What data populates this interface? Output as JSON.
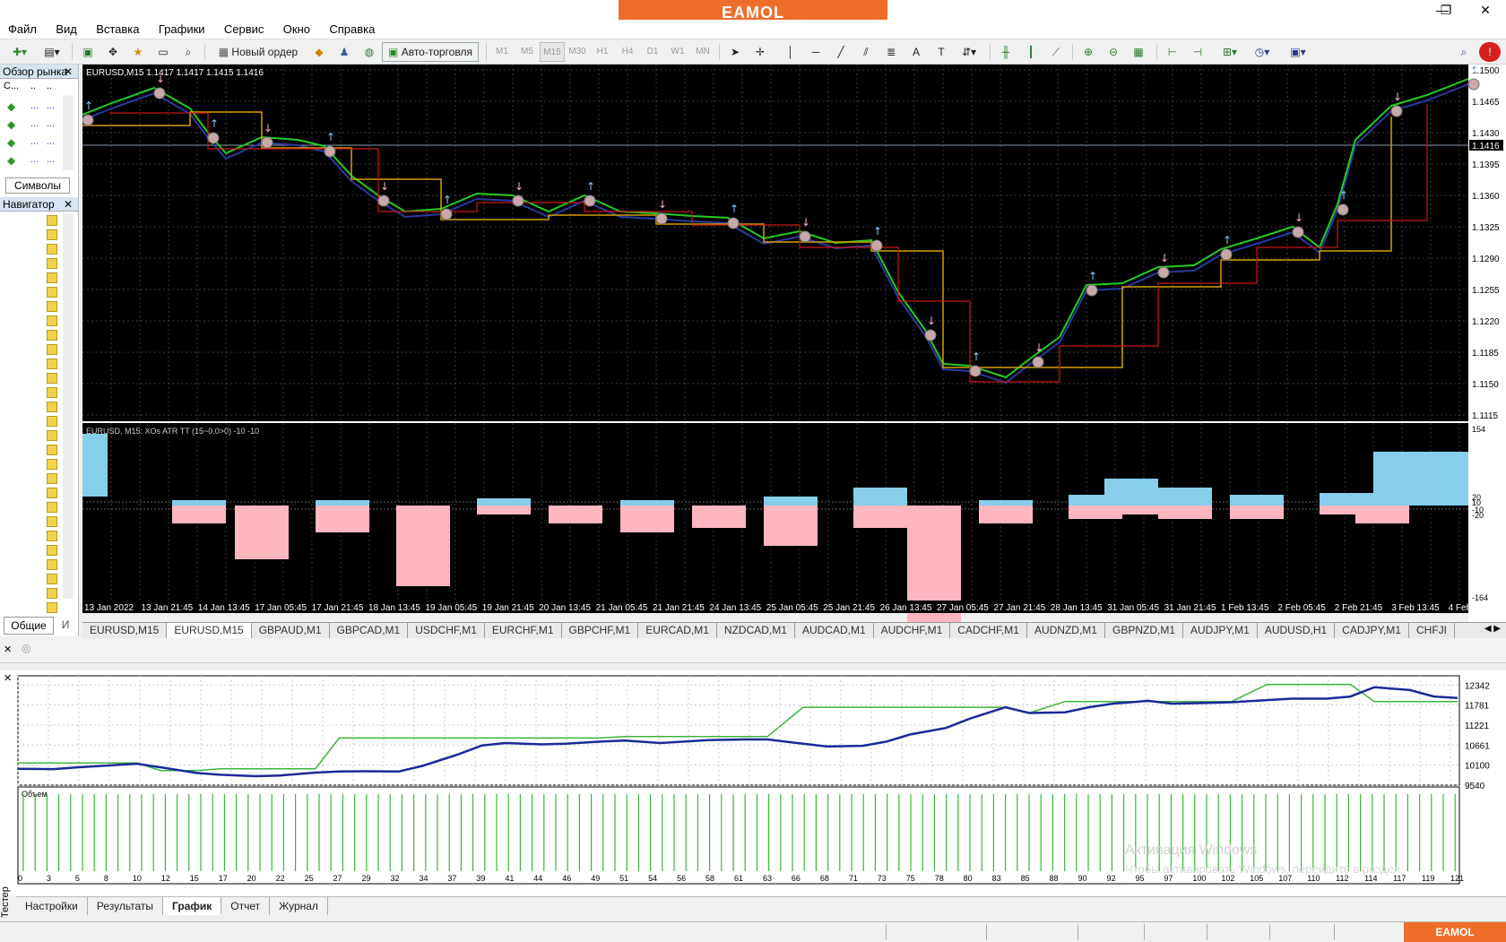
{
  "brand": "EAMOL",
  "window_controls": {
    "minimize": "—",
    "restore": "❐",
    "close": "✕"
  },
  "menu": [
    "Файл",
    "Вид",
    "Вставка",
    "Графики",
    "Сервис",
    "Окно",
    "Справка"
  ],
  "toolbar": {
    "new_order": "Новый ордер",
    "auto_trading": "Авто-торговля",
    "timeframes": [
      "M1",
      "M5",
      "M15",
      "M30",
      "H1",
      "H4",
      "D1",
      "W1",
      "MN"
    ]
  },
  "market_watch": {
    "title": "Обзор рынка",
    "col_symbol": "С...",
    "tab": "Символы",
    "rows": [
      "...",
      "...",
      "...",
      "..."
    ]
  },
  "navigator": {
    "title": "Навигатор",
    "tab_common": "Общие",
    "tab_other": "И"
  },
  "chart": {
    "title": "EURUSD,M15  1.1417 1.1417 1.1415 1.1416",
    "current_price": "1.1416",
    "price_ticks": [
      "1.1500",
      "1.1465",
      "1.1430",
      "1.1395",
      "1.1360",
      "1.1325",
      "1.1290",
      "1.1255",
      "1.1220",
      "1.1185",
      "1.1150",
      "1.1115"
    ],
    "indicator_title": "EURUSD, M15: XOs ATR TT (15~0.0>0)  -10 -10",
    "indicator_ticks": [
      "154",
      "20",
      "10",
      "-10",
      "-20",
      "-164"
    ],
    "time_labels": [
      "13 Jan 2022",
      "13 Jan 21:45",
      "14 Jan 13:45",
      "17 Jan 05:45",
      "17 Jan 21:45",
      "18 Jan 13:45",
      "19 Jan 05:45",
      "19 Jan 21:45",
      "20 Jan 13:45",
      "21 Jan 05:45",
      "21 Jan 21:45",
      "24 Jan 13:45",
      "25 Jan 05:45",
      "25 Jan 21:45",
      "26 Jan 13:45",
      "27 Jan 05:45",
      "27 Jan 21:45",
      "28 Jan 13:45",
      "31 Jan 05:45",
      "31 Jan 21:45",
      "1 Feb 13:45",
      "2 Feb 05:45",
      "2 Feb 21:45",
      "3 Feb 13:45",
      "4 Feb 05:45"
    ]
  },
  "chart_tabs": [
    "EURUSD,M15",
    "EURUSD,M15",
    "GBPAUD,M1",
    "GBPCAD,M1",
    "USDCHF,M1",
    "EURCHF,M1",
    "GBPCHF,M1",
    "EURCAD,M1",
    "NZDCAD,M1",
    "AUDCAD,M1",
    "AUDCHF,M1",
    "CADCHF,M1",
    "AUDNZD,M1",
    "GBPNZD,M1",
    "AUDJPY,M1",
    "AUDUSD,H1",
    "CADJPY,M1",
    "CHFJI"
  ],
  "tester": {
    "vertical_label": "Тестер",
    "volume_label": "Объем",
    "y_ticks": [
      "12342",
      "11781",
      "11221",
      "10661",
      "10100",
      "9540"
    ],
    "x_ticks": [
      "0",
      "3",
      "5",
      "8",
      "10",
      "12",
      "15",
      "17",
      "20",
      "22",
      "25",
      "27",
      "29",
      "32",
      "34",
      "37",
      "39",
      "41",
      "44",
      "46",
      "49",
      "51",
      "54",
      "56",
      "58",
      "61",
      "63",
      "66",
      "68",
      "71",
      "73",
      "75",
      "78",
      "80",
      "83",
      "85",
      "88",
      "90",
      "92",
      "95",
      "97",
      "100",
      "102",
      "105",
      "107",
      "110",
      "112",
      "114",
      "117",
      "119",
      "121"
    ],
    "tabs": [
      "Настройки",
      "Результаты",
      "График",
      "Отчет",
      "Журнал"
    ],
    "active_tab": "График",
    "watermark_line1": "Активация Windows",
    "watermark_line2": "Чтобы активировать Windows, перейдите в раздел"
  },
  "chart_data": {
    "type": "line",
    "title": "",
    "xlabel": "",
    "ylabel": "",
    "ylim": [
      9540,
      12600
    ],
    "x": [
      0,
      3,
      5,
      8,
      10,
      12,
      15,
      17,
      20,
      22,
      25,
      27,
      29,
      32,
      34,
      37,
      39,
      41,
      44,
      46,
      49,
      51,
      54,
      56,
      58,
      61,
      63,
      66,
      68,
      71,
      73,
      75,
      78,
      80,
      83,
      85,
      88,
      90,
      92,
      95,
      97,
      100,
      102,
      105,
      107,
      110,
      112,
      114,
      117,
      119,
      121
    ],
    "series": [
      {
        "color": "#1a2a9a",
        "values": [
          10000,
          9990,
          10040,
          10100,
          10140,
          10040,
          9880,
          9830,
          9790,
          9810,
          9890,
          9920,
          9930,
          9920,
          10080,
          10400,
          10650,
          10720,
          10680,
          10700,
          10760,
          10790,
          10720,
          10760,
          10800,
          10820,
          10820,
          10700,
          10620,
          10640,
          10760,
          10960,
          11140,
          11400,
          11720,
          11560,
          11580,
          11720,
          11820,
          11900,
          11820,
          11840,
          11860,
          11920,
          11960,
          11960,
          12020,
          12280,
          12200,
          12020,
          11980
        ]
      },
      {
        "color": "#3cb43c",
        "values": [
          10160,
          10160,
          10160,
          10160,
          10160,
          9950,
          9950,
          10000,
          10000,
          10000,
          10000,
          10860,
          10860,
          10860,
          10860,
          10860,
          10860,
          10860,
          10860,
          10860,
          10860,
          10900,
          10900,
          10900,
          10900,
          10900,
          10900,
          11720,
          11720,
          11720,
          11720,
          11720,
          11720,
          11720,
          11720,
          11560,
          11880,
          11880,
          11880,
          11880,
          11880,
          11880,
          11880,
          12360,
          12360,
          12360,
          12360,
          11880,
          11880,
          11880,
          11880
        ]
      }
    ]
  }
}
